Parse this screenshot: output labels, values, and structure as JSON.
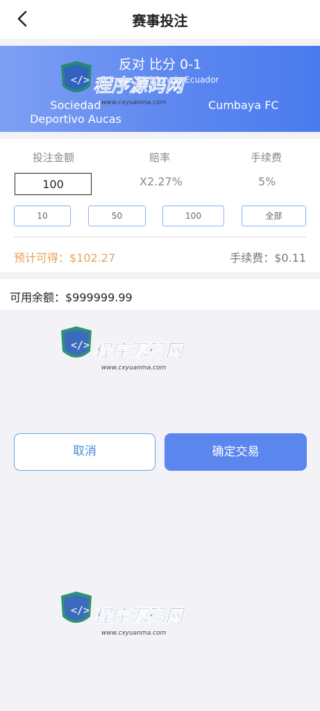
{
  "header": {
    "title": "赛事投注",
    "back_icon": "chevron-left-icon"
  },
  "match": {
    "score_line": "反对 比分 0-1",
    "league": "Primera Division de Ecuador",
    "home_team": "Sociedad Deportivo Aucas",
    "away_team": "Cumbaya FC"
  },
  "bet": {
    "amount_label": "投注金额",
    "odds_label": "赔率",
    "fee_label": "手续费",
    "amount_value": "100",
    "odds_value": "X2.27%",
    "fee_rate": "5%",
    "quick_amounts": [
      "10",
      "50",
      "100",
      "全部"
    ],
    "expected_text": "预计可得：$102.27",
    "fee_total_text": "手续费：$0.11"
  },
  "balance": {
    "text": "可用余额：$999999.99"
  },
  "actions": {
    "cancel_label": "取消",
    "confirm_label": "确定交易"
  },
  "watermark": {
    "brand": "程序源码网",
    "url": "www.cxyuanma.com"
  },
  "colors": {
    "accent": "#5a86ee",
    "banner_start": "#7ea0f4",
    "banner_end": "#4a7bee",
    "expected": "#e8a15a"
  }
}
